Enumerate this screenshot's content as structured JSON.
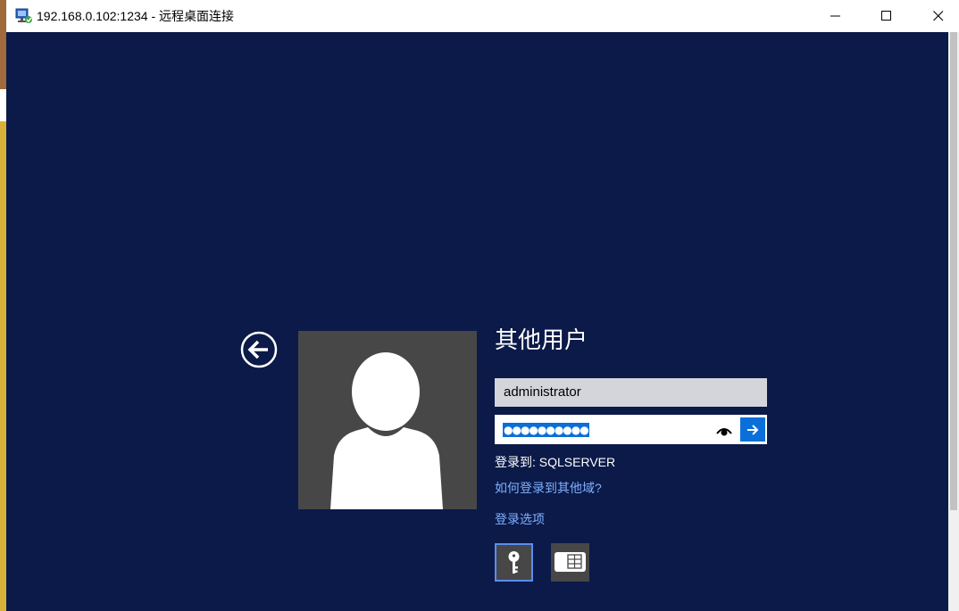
{
  "window": {
    "title": "192.168.0.102:1234 - 远程桌面连接",
    "icon": "remote-desktop-icon",
    "controls": [
      "minimize-icon",
      "maximize-icon",
      "close-icon"
    ]
  },
  "login": {
    "user_title": "其他用户",
    "username_value": "administrator",
    "password_masked": "●●●●●●●●●●",
    "sign_in_to": "登录到: SQLSERVER",
    "link_other_domain": "如何登录到其他域?",
    "link_sign_in_options": "登录选项",
    "options": [
      {
        "icon": "key-icon",
        "selected": true
      },
      {
        "icon": "smart-card-icon",
        "selected": false
      }
    ]
  },
  "colors": {
    "background": "#0b1a48",
    "accent": "#0a6fd8",
    "link": "#7fb0ff",
    "tile": "#474747"
  }
}
